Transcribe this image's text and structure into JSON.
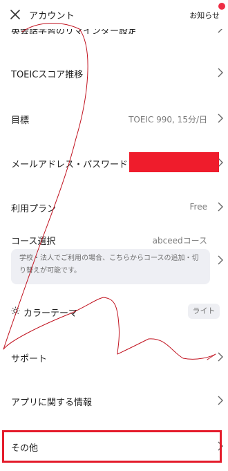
{
  "header": {
    "title": "アカウント",
    "close_icon": "close-icon",
    "notice_label": "お知らせ",
    "notice_dot_color": "#ee2d44"
  },
  "items": {
    "clipped": "英会話学習のリマインダー設定",
    "toeic": "TOEICスコア推移",
    "goal": "目標",
    "goal_value": "TOEIC 990, 15分/日",
    "email": "メールアドレス・パスワード",
    "plan": "利用プラン",
    "plan_value": "Free",
    "course": "コース選択",
    "course_value": "abceedコース",
    "course_note": "学校・法人でご利用の場合、こちらからコースの追加・切り替えが可能です。",
    "theme": "カラーテーマ",
    "theme_value": "ライト",
    "support": "サポート",
    "app_info": "アプリに関する情報",
    "other": "その他"
  },
  "colors": {
    "redaction": "#ef1c2c",
    "annotation": "#e41b2b"
  }
}
